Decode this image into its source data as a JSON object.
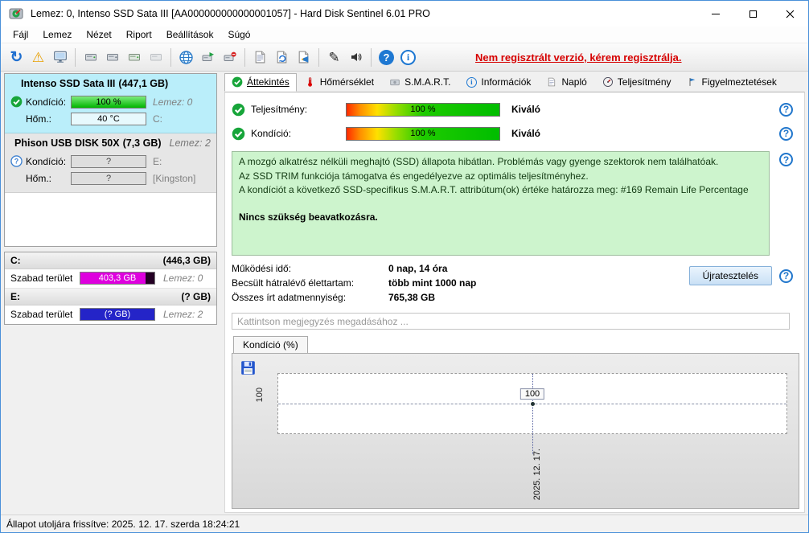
{
  "window": {
    "title": "Lemez: 0, Intenso SSD Sata III [AA000000000000001057]  -  Hard Disk Sentinel 6.01 PRO"
  },
  "menu": {
    "items": [
      "Fájl",
      "Lemez",
      "Nézet",
      "Riport",
      "Beállítások",
      "Súgó"
    ]
  },
  "toolbar": {
    "register_link": "Nem regisztrált verzió, kérem regisztrálja."
  },
  "icons": {
    "refresh": "↻",
    "warning": "⚠",
    "pen": "✎",
    "help": "?",
    "info": "i",
    "question": "?"
  },
  "sidebar": {
    "disks": [
      {
        "name": "Intenso SSD Sata III",
        "size": "(447,1 GB)",
        "kondicio_label": "Kondíció:",
        "kondicio_value": "100 %",
        "lemez": "Lemez: 0",
        "hom_label": "Hőm.:",
        "hom_value": "40 °C",
        "drive": "C:"
      },
      {
        "name": "Phison  USB DISK 50X",
        "size": "(7,3 GB)",
        "lemez": "Lemez: 2",
        "kondicio_label": "Kondíció:",
        "kondicio_value": "?",
        "drive": "E:",
        "hom_label": "Hőm.:",
        "hom_value": "?",
        "extra": "[Kingston]"
      }
    ],
    "partitions": [
      {
        "drive": "C:",
        "size": "(446,3 GB)",
        "free_label": "Szabad terület",
        "free_value": "403,3 GB",
        "lemez": "Lemez: 0"
      },
      {
        "drive": "E:",
        "size": "(? GB)",
        "free_label": "Szabad terület",
        "free_value": "(? GB)",
        "lemez": "Lemez: 2"
      }
    ]
  },
  "tabs": {
    "items": [
      "Áttekintés",
      "Hőmérséklet",
      "S.M.A.R.T.",
      "Információk",
      "Napló",
      "Teljesítmény",
      "Figyelmeztetések"
    ]
  },
  "overview": {
    "performance_label": "Teljesítmény:",
    "performance_value": "100 %",
    "performance_rating": "Kiváló",
    "health_label": "Kondíció:",
    "health_value": "100 %",
    "health_rating": "Kiváló",
    "status_line1": "A mozgó alkatrész nélküli meghajtó (SSD) állapota hibátlan. Problémás vagy gyenge szektorok nem találhatóak.",
    "status_line2": "Az SSD TRIM funkciója támogatva és engedélyezve az optimális teljesítményhez.",
    "status_line3": "A kondíciót a következő SSD-specifikus S.M.A.R.T. attribútum(ok) értéke határozza meg:  #169 Remain Life Percentage",
    "status_bold": "Nincs szükség beavatkozásra.",
    "power_on_label": "Működési idő:",
    "power_on_value": "0 nap, 14 óra",
    "lifetime_label": "Becsült hátralévő élettartam:",
    "lifetime_value": "több mint 1000 nap",
    "written_label": "Összes írt adatmennyiség:",
    "written_value": "765,38 GB",
    "retest_button": "Újratesztelés",
    "comment_placeholder": "Kattintson megjegyzés megadásához ..."
  },
  "chart_data": {
    "type": "line",
    "title": "Kondíció  (%)",
    "x": [
      "2025. 12. 17."
    ],
    "values": [
      100
    ],
    "ylabel_tick": "100",
    "point_label": "100",
    "grid": "dashed",
    "legend": "none"
  },
  "statusbar": {
    "text": "Állapot utoljára frissítve: 2025. 12. 17. szerda 18:24:21"
  }
}
